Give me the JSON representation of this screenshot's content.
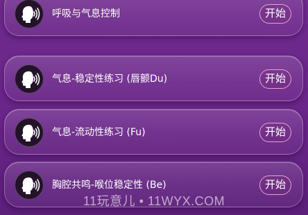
{
  "exercises": [
    {
      "title": "呼吸与气息控制",
      "button_label": "开始",
      "icon": "speaking-head-icon"
    },
    {
      "title": "气息-稳定性练习 (唇颤Du)",
      "button_label": "开始",
      "icon": "speaking-head-icon"
    },
    {
      "title": "气息-流动性练习 (Fu)",
      "button_label": "开始",
      "icon": "speaking-head-icon"
    },
    {
      "title": "胸腔共鸣-喉位稳定性 (Be)",
      "button_label": "开始",
      "icon": "speaking-head-icon"
    }
  ],
  "watermark": "11玩意儿 • 11WYX.COM",
  "colors": {
    "background": "#6a2589",
    "button_border": "#e7a3cf",
    "avatar_bg": "#231229"
  }
}
